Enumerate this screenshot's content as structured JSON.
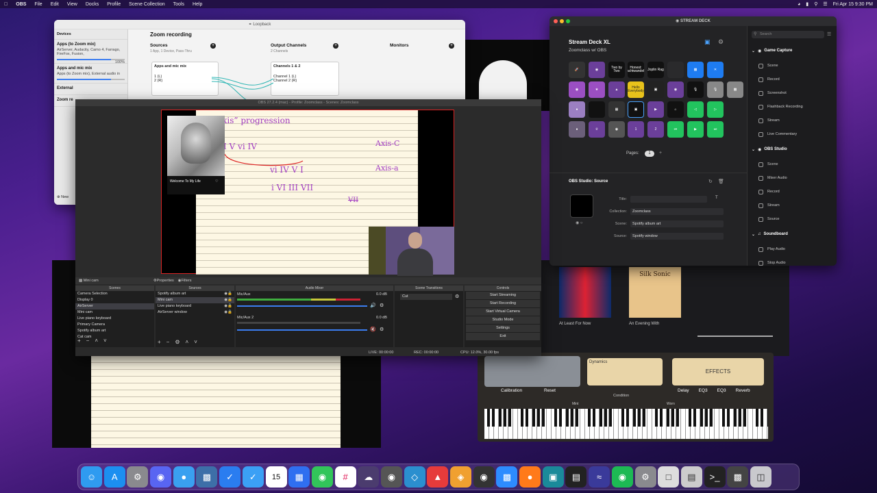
{
  "menubar": {
    "app": "OBS",
    "items": [
      "File",
      "Edit",
      "View",
      "Docks",
      "Profile",
      "Scene Collection",
      "Tools",
      "Help"
    ],
    "clock": "Fri Apr 15  9:30 PM"
  },
  "loopback": {
    "title": "Loopback",
    "devices_header": "Devices",
    "devices": [
      {
        "name": "Apps (to Zoom mix)",
        "desc": "AirServer, Audacity, Camo 4, Farrago, FireFox, Fusion,",
        "toggle": "On",
        "level": "100%"
      },
      {
        "name": "Apps and mic mix",
        "desc": "Apps (to Zoom mix), External audio in",
        "toggle": "On"
      },
      {
        "name": "External",
        "desc": ""
      },
      {
        "name": "Zoom re",
        "desc": ""
      }
    ],
    "new_label": "New",
    "device_title": "Zoom recording",
    "sources_label": "Sources",
    "sources_desc": "1 App, 1 Device, Pass-Thru",
    "source_box": "Apps and mic mix",
    "source_box_toggle": "On",
    "output_label": "Output Channels",
    "output_desc": "2 Channels",
    "output_box": "Channels 1 & 2",
    "out_ch1": "Channel 1 (L)",
    "out_ch2": "Channel 2 (R)",
    "src_ch1": "1 (L)",
    "src_ch2": "2 (R)",
    "monitors_label": "Monitors"
  },
  "deck": {
    "title": "STREAM DECK",
    "device": "Stream Deck XL",
    "profile": "Zoomclass w/ OBS",
    "pages_label": "Pages:",
    "page": "1",
    "keys_text": {
      "two": "Two by Two",
      "honest": "Honest: Nachtwandeler",
      "joplin": "Joplin Rag",
      "hello": "Hello Everybody"
    },
    "section_title": "OBS Studio: Source",
    "fields": {
      "title_label": "Title:",
      "collection_label": "Collection:",
      "collection": "Zoomclass",
      "scene_label": "Scene:",
      "scene": "Spotify album art",
      "source_label": "Source:",
      "source": "Spotify window"
    },
    "search_placeholder": "Search",
    "groups": [
      {
        "name": "Game Capture",
        "items": [
          "Scene",
          "Record",
          "Screenshot",
          "Flashback Recording",
          "Stream",
          "Live Commentary"
        ]
      },
      {
        "name": "OBS Studio",
        "items": [
          "Scene",
          "Mixer Audio",
          "Record",
          "Stream",
          "Source"
        ]
      },
      {
        "name": "Soundboard",
        "items": [
          "Play Audio",
          "Stop Audio"
        ]
      }
    ]
  },
  "obs": {
    "title": "OBS 27.2.4 (mac) - Profile: Zoomclass - Scenes: Zoomclass",
    "album_title": "Welcome To My Life",
    "handwriting": {
      "prog": "“ Axis”  progression",
      "row1": "I   V   vi   IV",
      "axis_c": "Axis-C",
      "row2": "vi   IV   V   I",
      "axis_a": "Axis-a",
      "row3": "i   VI   III   VII",
      "strike": "VII"
    },
    "dock_bar": {
      "source": "Mini cam",
      "properties": "Properties",
      "filters": "Filters"
    },
    "panels": {
      "scenes": "Scenes",
      "sources": "Sources",
      "mixer": "Audio Mixer",
      "transitions": "Scene Transitions",
      "controls": "Controls"
    },
    "scenes": [
      "Camera Selection",
      "Display 0",
      "AirServer",
      "Mini cam",
      "Live piano keyboard",
      "Primary Camera",
      "Spotify album art",
      "Cat cam"
    ],
    "sources": [
      "Spotify album art",
      "Mini cam",
      "Live piano keyboard",
      "AirServer window"
    ],
    "mixer": [
      {
        "name": "Mic/Aux",
        "db": "0.0 dB"
      },
      {
        "name": "Mic/Aux 2",
        "db": "0.0 dB"
      }
    ],
    "transition": "Cut",
    "controls": [
      "Start Streaming",
      "Start Recording",
      "Start Virtual Camera",
      "Studio Mode",
      "Settings",
      "Exit"
    ],
    "status": {
      "live": "LIVE: 00:00:00",
      "rec": "REC: 00:00:00",
      "cpu": "CPU: 12.0%, 30.00 fps"
    }
  },
  "albums": [
    {
      "title": "Silk Sonic",
      "caption": "An Evening With"
    },
    {
      "title": "",
      "caption": "At Least For Now"
    }
  ],
  "piano": {
    "dynamics": "Dynamics",
    "effects": "EFFECTS",
    "calibration": "Calibration",
    "reset": "Reset",
    "condition": "Condition",
    "mint": "Mint",
    "worn": "Worn",
    "fx": [
      "Delay",
      "EQ3",
      "EQ3",
      "Reverb"
    ]
  },
  "dock_icons": [
    "finder-icon",
    "app-store-icon",
    "system-preferences-icon",
    "discord-icon",
    "tweetbot-icon",
    "screen-sharing-icon",
    "tasks-icon",
    "things-icon",
    "calendar-icon",
    "keynote-icon",
    "messages-icon",
    "slack-icon",
    "cloud-icon",
    "robot-icon",
    "network-icon",
    "parcel-icon",
    "butterfly-icon",
    "obs-icon",
    "zoom-icon",
    "firefox-icon",
    "streamdeck-icon",
    "tv-icon",
    "waves-icon",
    "spotify-icon",
    "automator-icon",
    "file-icon",
    "window-icon",
    "terminal-icon",
    "screen-icon",
    "trash-icon"
  ],
  "dock_calendar_day": "15",
  "colors": {
    "accent": "#3b7df0",
    "obs_red": "#dd2222",
    "handwriting": "#a23ec2",
    "deck_green": "#22c35e"
  }
}
